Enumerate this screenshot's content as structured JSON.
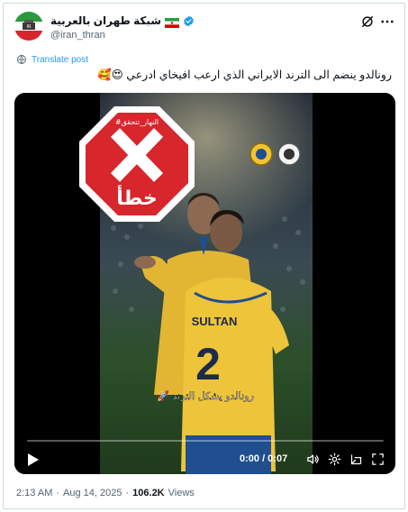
{
  "author": {
    "display_name": "شبكة طهران بالعربية",
    "handle": "@iran_thran",
    "flag_emoji": "🇮🇷",
    "verified_color": "#1d9bf0"
  },
  "actions": {
    "grok_icon": "grok-icon",
    "more_icon": "more-icon"
  },
  "translate_label": "Translate post",
  "post_text": "رونالدو ينضم الى الترند الايراني الذي ارعب افيخاي ادرعي 😍🥰",
  "media": {
    "stamp_tag": "#النهار_تتحقق",
    "stamp_word": "خطأ",
    "caption": "رونالدو يشكل الترند 🚀",
    "jersey_name": "SULTAN",
    "jersey_number": "2",
    "stamp_color": "#d7262c"
  },
  "player": {
    "time": "0:00 / 0:07",
    "progress": 0.0
  },
  "meta": {
    "time": "2:13 AM",
    "separator": "·",
    "date": "Aug 14, 2025",
    "views_count": "106.2K",
    "views_label": "Views"
  }
}
